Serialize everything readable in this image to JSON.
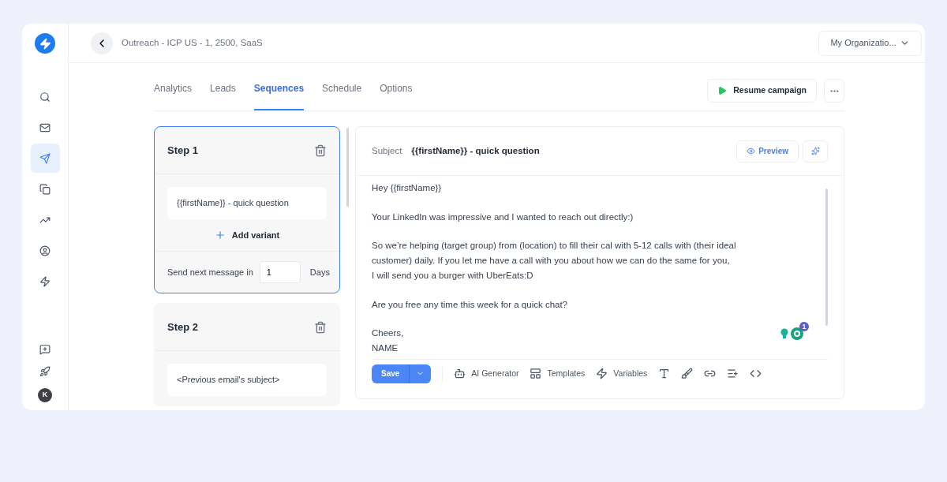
{
  "sidebar": {
    "items": [
      {
        "kind": "search",
        "selected": false
      },
      {
        "kind": "mail",
        "selected": false
      },
      {
        "kind": "send",
        "selected": true
      },
      {
        "kind": "copy",
        "selected": false
      },
      {
        "kind": "trend",
        "selected": false
      },
      {
        "kind": "user",
        "selected": false
      },
      {
        "kind": "zap",
        "selected": false
      }
    ],
    "bottom_items": [
      {
        "kind": "feedback"
      },
      {
        "kind": "rocket"
      }
    ],
    "avatar": "K"
  },
  "header": {
    "title": "Outreach - ICP US - 1, 2500, SaaS",
    "organization": "My Organizatio..."
  },
  "tabs": [
    {
      "label": "Analytics",
      "selected": false
    },
    {
      "label": "Leads",
      "selected": false
    },
    {
      "label": "Sequences",
      "selected": true
    },
    {
      "label": "Schedule",
      "selected": false
    },
    {
      "label": "Options",
      "selected": false
    }
  ],
  "resume_button": "Resume campaign",
  "steps": [
    {
      "title": "Step 1",
      "selected": true,
      "variant_subject": "{{firstName}} - quick question",
      "add_variant": "Add variant",
      "delay_label": "Send next message in",
      "delay_value": "1",
      "delay_unit": "Days"
    },
    {
      "title": "Step 2",
      "selected": false,
      "variant_subject": "<Previous email's subject>"
    }
  ],
  "editor": {
    "subject_label": "Subject",
    "subject": "{{firstName}} - quick question",
    "preview": "Preview",
    "body": [
      [
        "Hey {{firstName}}"
      ],
      [
        "Your LinkedIn was impressive and I wanted to reach out directly:)"
      ],
      [
        "So we’re helping (target group) from (location) to fill their cal with 5-12 calls with (their ideal",
        "customer) daily. If you let me have a call with you about how we can do the same for you,",
        "I will send you a burger with UberEats:D"
      ],
      [
        "Are you free any time this week for a quick chat?"
      ],
      [
        "Cheers,",
        "NAME"
      ]
    ],
    "grammarly_count": "1",
    "save": "Save",
    "toolbar": [
      {
        "kind": "ai",
        "label": "AI Generator"
      },
      {
        "kind": "templates",
        "label": "Templates"
      },
      {
        "kind": "variables",
        "label": "Variables"
      },
      {
        "kind": "font"
      },
      {
        "kind": "brush"
      },
      {
        "kind": "link"
      },
      {
        "kind": "insert"
      },
      {
        "kind": "code"
      }
    ]
  }
}
